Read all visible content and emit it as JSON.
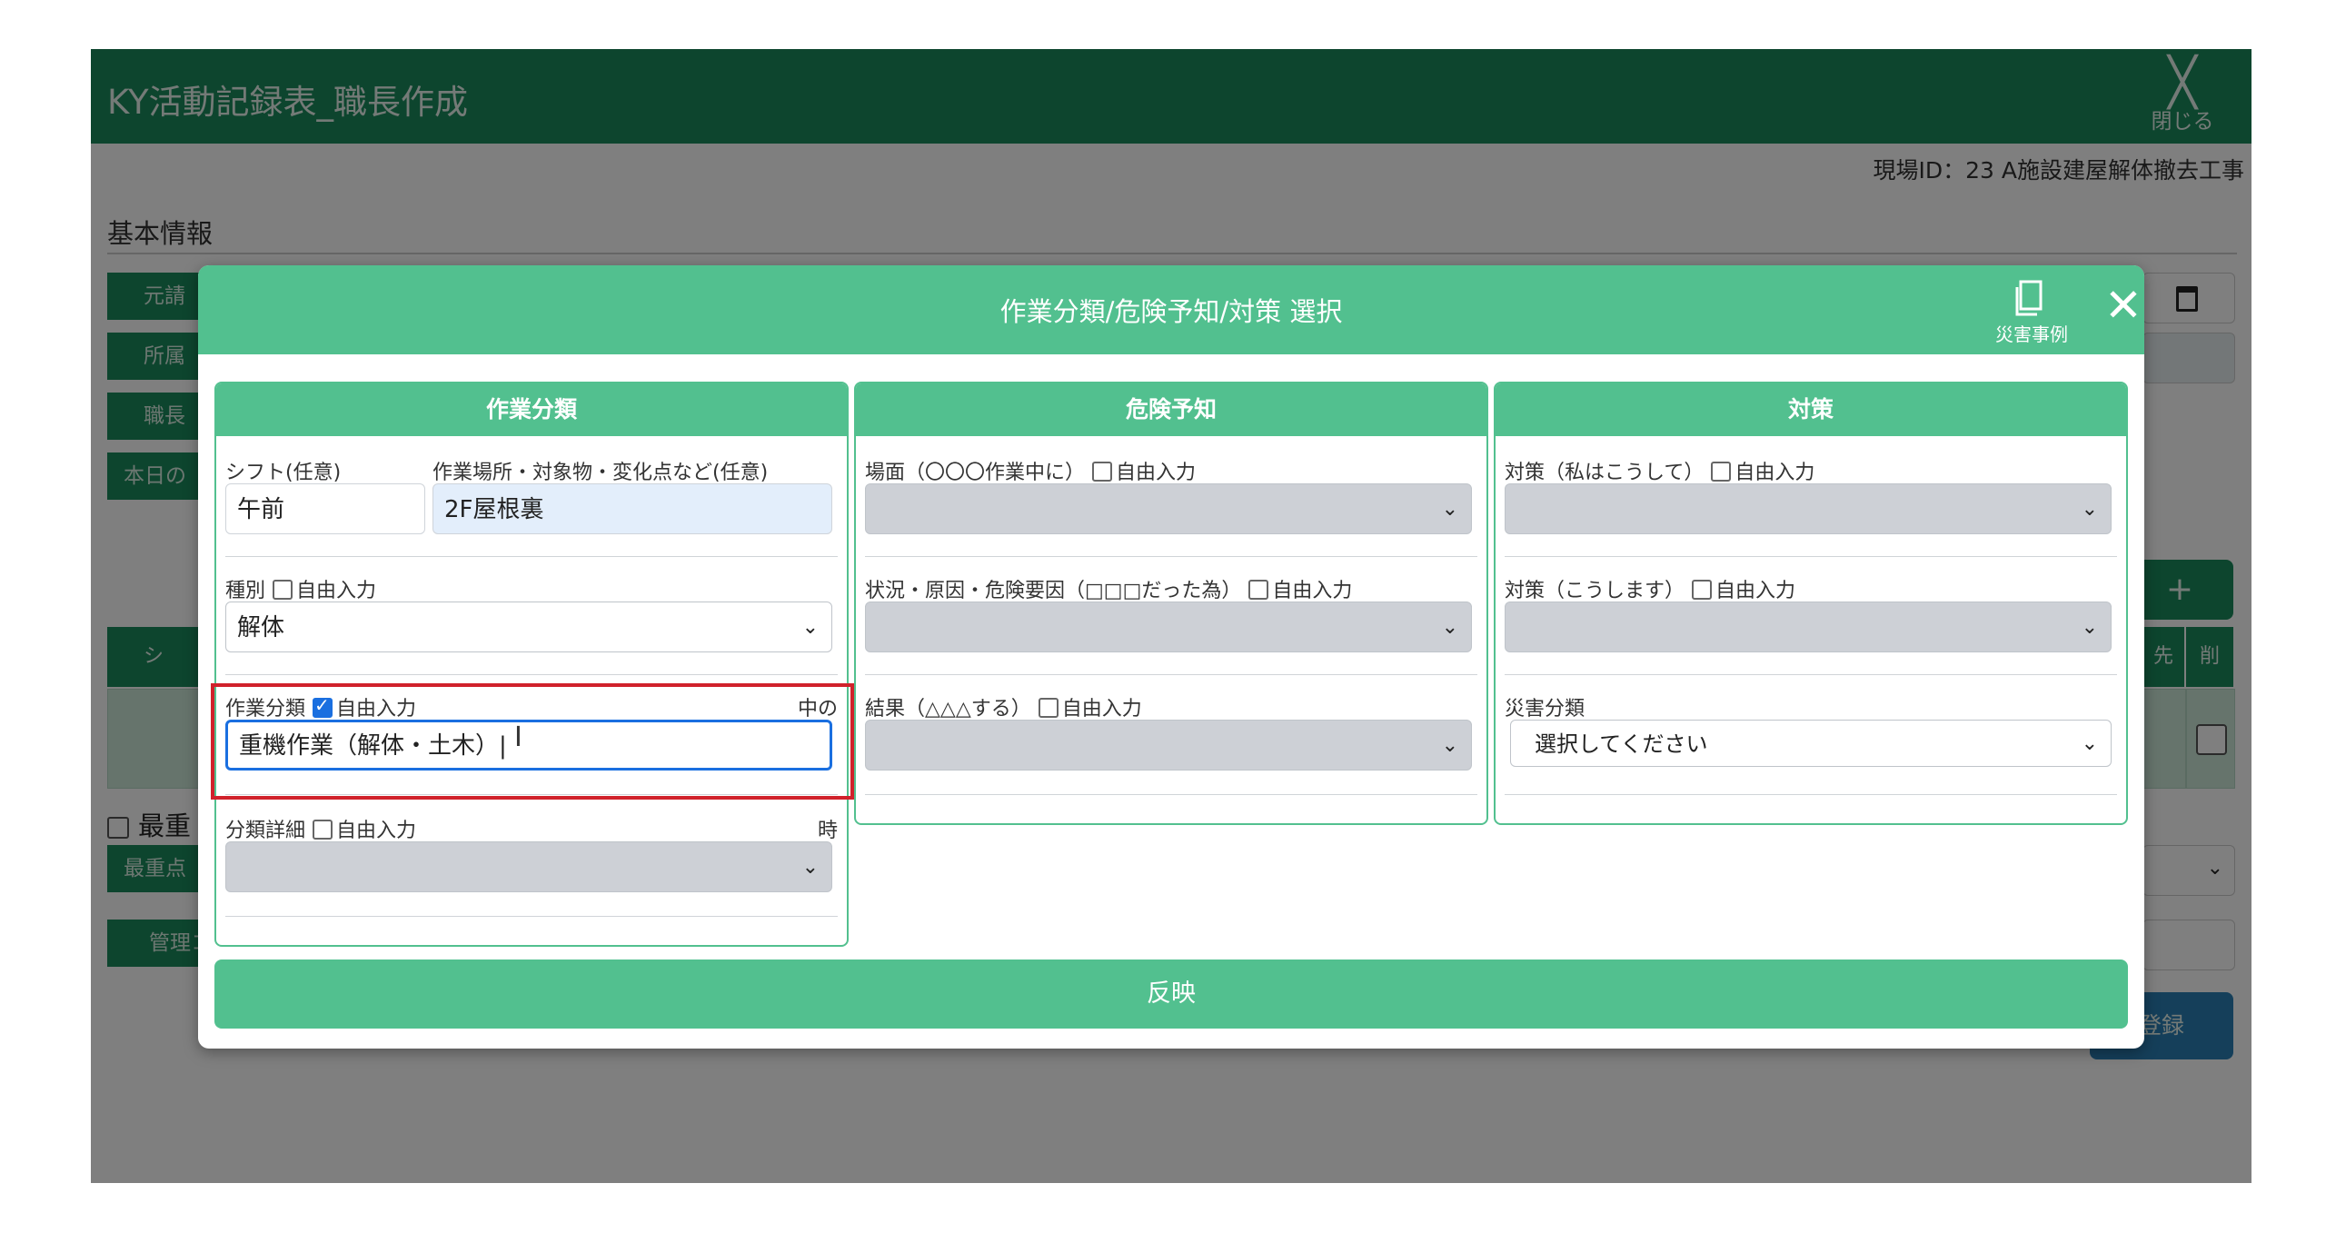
{
  "app": {
    "title": "KY活動記録表_職長作成",
    "close_label": "閉じる",
    "close_symbol": "╳",
    "site_id": "現場ID：23 A施設建屋解体撤去工事",
    "section_title": "基本情報",
    "side_buttons": [
      "元請",
      "所属",
      "職長",
      "本日の"
    ],
    "lower_side_buttons": [
      "最重点",
      "管理コ"
    ],
    "important_check_label": "最重",
    "grid_head_left": "シ",
    "grid_head_right": [
      "先",
      "削"
    ],
    "register_label": "登録",
    "plus_label": "+"
  },
  "modal": {
    "title": "作業分類/危険予知/対策 選択",
    "case_label": "災害事例",
    "close_symbol": "✕",
    "reflect_label": "反映"
  },
  "panels": {
    "work": {
      "header": "作業分類",
      "shift_label": "シフト(任意)",
      "shift_value": "午前",
      "place_label": "作業場所・対象物・変化点など(任意)",
      "place_value": "2F屋根裏",
      "type_label": "種別",
      "type_free": "自由入力",
      "type_value": "解体",
      "category_label": "作業分類",
      "category_free": "自由入力",
      "category_suffix": "中の",
      "category_value": "重機作業（解体・土木）|",
      "detail_label": "分類詳細",
      "detail_free": "自由入力",
      "detail_suffix": "時"
    },
    "danger": {
      "header": "危険予知",
      "scene_label": "場面（〇〇〇作業中に）",
      "scene_free": "自由入力",
      "cause_label": "状況・原因・危険要因（□□□だった為）",
      "cause_free": "自由入力",
      "result_label": "結果（△△△する）",
      "result_free": "自由入力"
    },
    "measure": {
      "header": "対策",
      "m1_label": "対策（私はこうして）",
      "m1_free": "自由入力",
      "m2_label": "対策（こうします）",
      "m2_free": "自由入力",
      "disaster_label": "災害分類",
      "disaster_value": "選択してください"
    }
  },
  "colors": {
    "app_header": "#1a8a5c",
    "modal_accent": "#52c08f",
    "focus_border": "#1a6fe0",
    "highlight": "#d0212b"
  },
  "icons": {
    "chevron": "chevron-down-icon",
    "case": "document-icon",
    "cursor": "text-cursor-icon"
  }
}
